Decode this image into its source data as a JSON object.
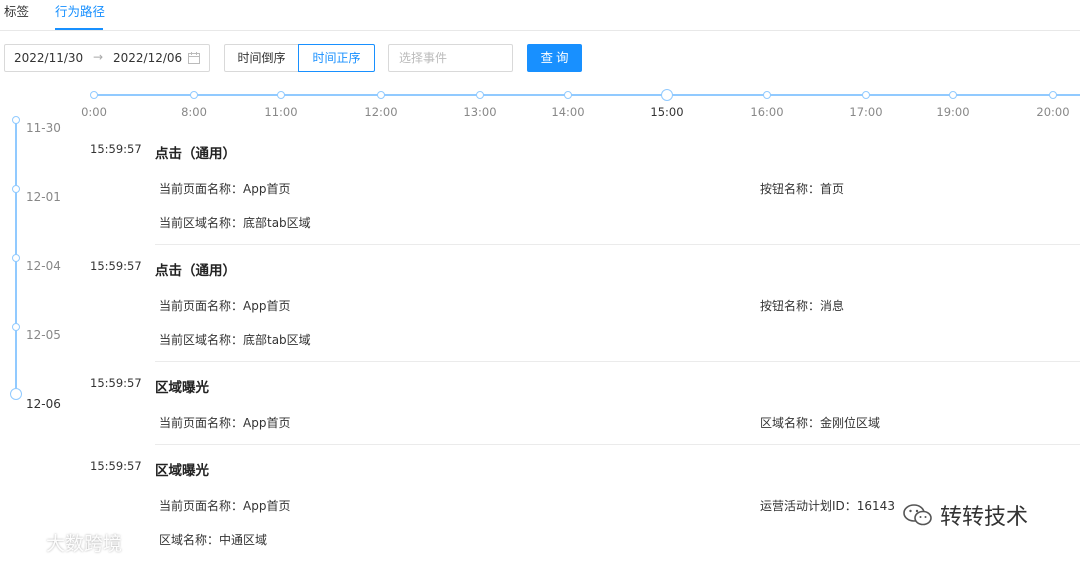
{
  "tabs": [
    {
      "label": "标签"
    },
    {
      "label": "行为路径"
    }
  ],
  "filters": {
    "date_start": "2022/11/30",
    "date_separator": "→",
    "date_end": "2022/12/06",
    "sort_desc_label": "时间倒序",
    "sort_asc_label": "时间正序",
    "event_placeholder": "选择事件",
    "query_label": "查询"
  },
  "time_axis": {
    "ticks": [
      "0:00",
      "8:00",
      "11:00",
      "12:00",
      "13:00",
      "14:00",
      "15:00",
      "16:00",
      "17:00",
      "19:00",
      "20:00"
    ],
    "active": "15:00"
  },
  "dates": {
    "items": [
      "11-30",
      "12-01",
      "12-04",
      "12-05",
      "12-06"
    ],
    "active": "12-06"
  },
  "events": [
    {
      "time": "15:59:57",
      "title": "点击（通用）",
      "fields": [
        "当前页面名称：App首页",
        "按钮名称：首页",
        "当前区域名称：底部tab区域"
      ]
    },
    {
      "time": "15:59:57",
      "title": "点击（通用）",
      "fields": [
        "当前页面名称：App首页",
        "按钮名称：消息",
        "当前区域名称：底部tab区域"
      ]
    },
    {
      "time": "15:59:57",
      "title": "区域曝光",
      "fields": [
        "当前页面名称：App首页",
        "区域名称：金刚位区域"
      ]
    },
    {
      "time": "15:59:57",
      "title": "区域曝光",
      "fields": [
        "当前页面名称：App首页",
        "运营活动计划ID：16143",
        "区域名称：中通区域"
      ]
    }
  ],
  "watermarks": {
    "left": "大数跨境",
    "right": "转转技术"
  },
  "colors": {
    "primary": "#1890ff",
    "timeline": "#91caff",
    "border": "#d9d9d9"
  }
}
